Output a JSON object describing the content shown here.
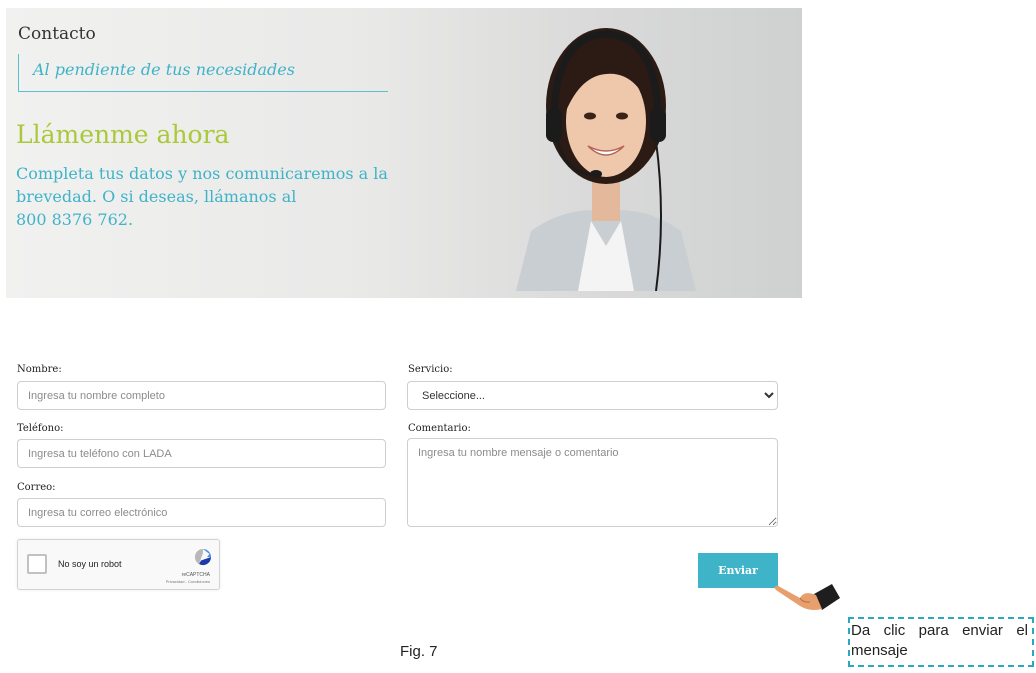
{
  "banner": {
    "title": "Contacto",
    "tagline": "Al pendiente de tus necesidades",
    "heading": "Llámenme ahora",
    "description": "Completa tus datos y nos comunicaremos a la brevedad. O si deseas, llámanos al",
    "phone": "800 8376 762."
  },
  "form": {
    "nombre": {
      "label": "Nombre:",
      "placeholder": "Ingresa tu nombre completo"
    },
    "telefono": {
      "label": "Teléfono:",
      "placeholder": "Ingresa tu teléfono con LADA"
    },
    "correo": {
      "label": "Correo:",
      "placeholder": "Ingresa tu correo electrónico"
    },
    "servicio": {
      "label": "Servicio:",
      "selected": "Seleccione..."
    },
    "comentario": {
      "label": "Comentario:",
      "placeholder": "Ingresa tu nombre mensaje o comentario"
    },
    "submit_label": "Enviar"
  },
  "recaptcha": {
    "label": "No soy un robot",
    "brand": "reCAPTCHA",
    "terms": "Privacidad - Condiciones"
  },
  "figure_caption": "Fig. 7",
  "callout": "Da clic para enviar el mensaje",
  "colors": {
    "accent": "#3fb3c8",
    "heading_green": "#a9c93a",
    "callout_border": "#2aa7c2"
  }
}
